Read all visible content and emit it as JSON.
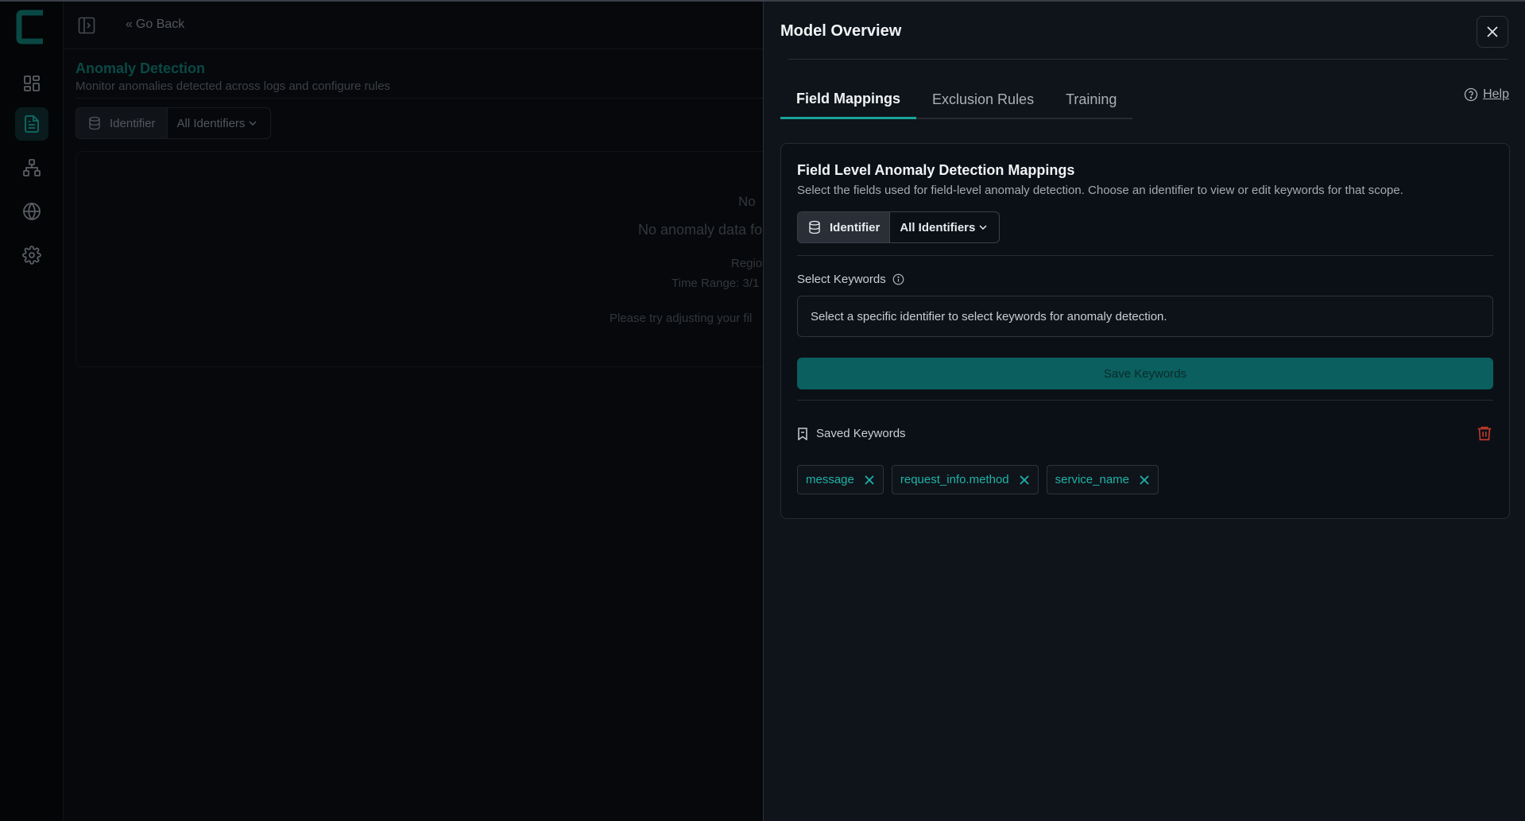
{
  "background": {
    "go_back_label": "Go Back",
    "title": "Anomaly Detection",
    "subtitle": "Monitor anomalies detected across logs and configure rules",
    "filter": {
      "identifier_label": "Identifier",
      "select_value": "All Identifiers"
    },
    "empty_state": {
      "heading": "No",
      "line1": "No anomaly data fo",
      "region": "Regio",
      "time_range": "Time Range: 3/1",
      "hint": "Please try adjusting your fil"
    }
  },
  "drawer": {
    "title": "Model Overview",
    "tabs": [
      {
        "label": "Field Mappings",
        "active": true
      },
      {
        "label": "Exclusion Rules",
        "active": false
      },
      {
        "label": "Training",
        "active": false
      }
    ],
    "help_label": "Help",
    "panel": {
      "title": "Field Level Anomaly Detection Mappings",
      "description": "Select the fields used for field-level anomaly detection. Choose an identifier to view or edit keywords for that scope.",
      "filter": {
        "identifier_label": "Identifier",
        "select_value": "All Identifiers"
      },
      "select_keywords_label": "Select Keywords",
      "keywords_placeholder": "Select a specific identifier to select keywords for anomaly detection.",
      "save_label": "Save Keywords",
      "saved_keywords_label": "Saved Keywords",
      "saved_keywords": [
        "message",
        "request_info.method",
        "service_name"
      ]
    }
  },
  "colors": {
    "accent": "#1aa39a",
    "button_bg": "#0b5f5f",
    "danger": "#c0392b"
  },
  "icons": {
    "logo": "brand-c-logo",
    "nav": [
      "dashboard-icon",
      "document-icon",
      "hierarchy-icon",
      "globe-icon",
      "gear-icon"
    ],
    "close": "close-icon",
    "help": "help-circle-icon",
    "info": "info-icon",
    "database": "database-icon",
    "bookmark": "bookmark-icon",
    "trash": "trash-icon"
  }
}
